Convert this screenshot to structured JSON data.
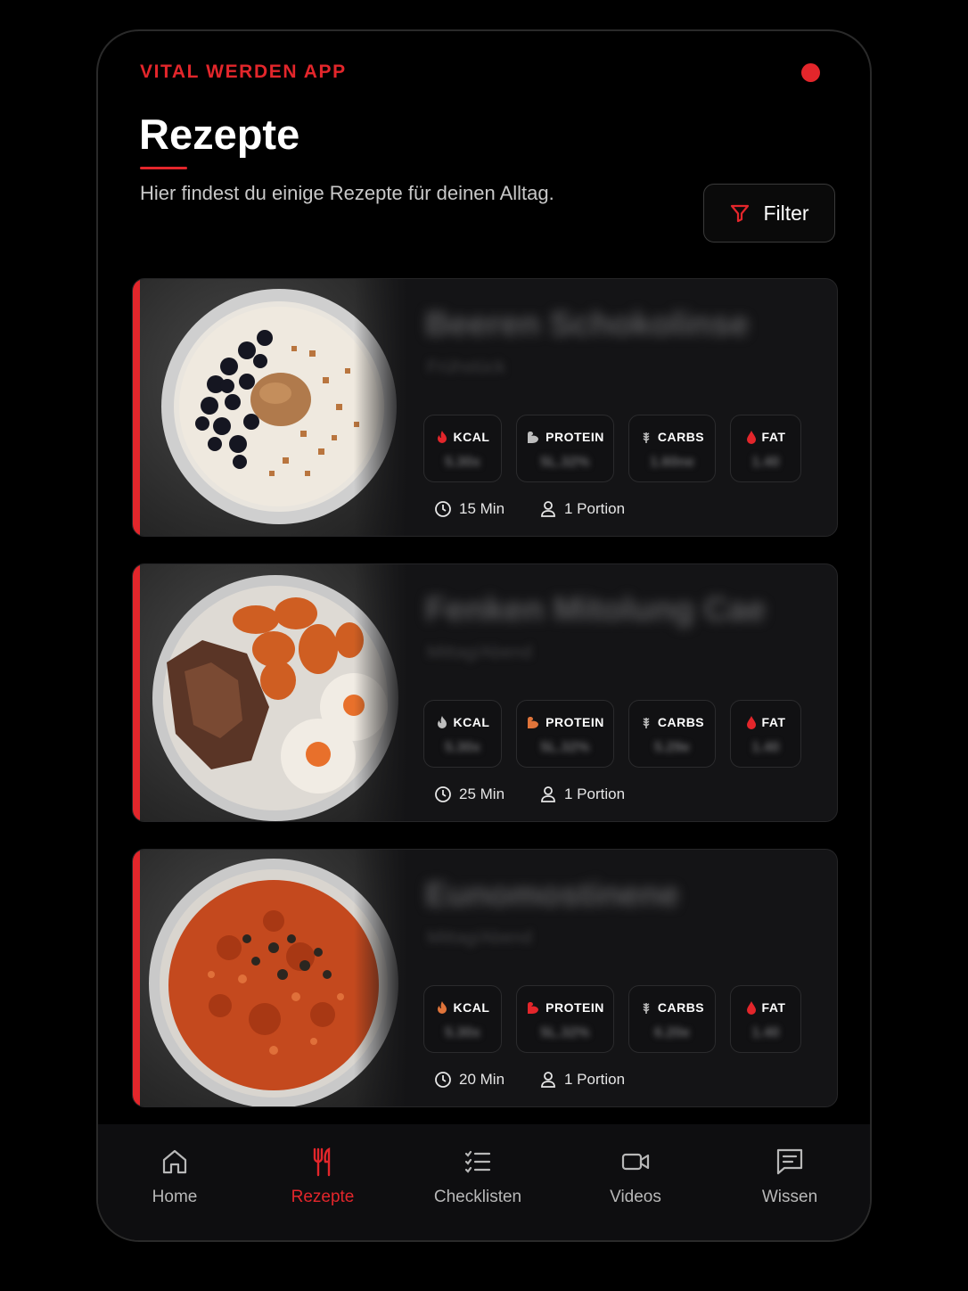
{
  "app": {
    "brand": "VITAL WERDEN APP",
    "title": "Rezepte",
    "subtitle": "Hier findest du einige Rezepte für deinen Alltag.",
    "filter_label": "Filter",
    "accent": "#e3262b"
  },
  "macro_labels": {
    "kcal": "KCAL",
    "protein": "PROTEIN",
    "carbs": "CARBS",
    "fat": "FAT"
  },
  "recipes": [
    {
      "name": "Beeren Schokolinse",
      "category": "Frühstück",
      "kcal": "5.30x",
      "protein": "5L.32%",
      "carbs": "1.60ne",
      "fat": "1.40",
      "time": "15 Min",
      "portion": "1 Portion",
      "image": "oatmeal-bowl-with-blueberries"
    },
    {
      "name": "Fenken Mitolung Cae",
      "category": "Mittag/Abend",
      "kcal": "5.30x",
      "protein": "5L.32%",
      "carbs": "5.29e",
      "fat": "1.40",
      "time": "25 Min",
      "portion": "1 Portion",
      "image": "steak-sweet-potato-eggs-plate"
    },
    {
      "name": "Eunomostinene",
      "category": "Mittag/Abend",
      "kcal": "5.30x",
      "protein": "5L.32%",
      "carbs": "6.20e",
      "fat": "1.40",
      "time": "20 Min",
      "portion": "1 Portion",
      "image": "tomato-risotto-bowl"
    }
  ],
  "nav": [
    {
      "label": "Home",
      "icon": "home-icon",
      "active": false
    },
    {
      "label": "Rezepte",
      "icon": "fork-knife-icon",
      "active": true
    },
    {
      "label": "Checklisten",
      "icon": "checklist-icon",
      "active": false
    },
    {
      "label": "Videos",
      "icon": "video-icon",
      "active": false
    },
    {
      "label": "Wissen",
      "icon": "message-icon",
      "active": false
    }
  ]
}
